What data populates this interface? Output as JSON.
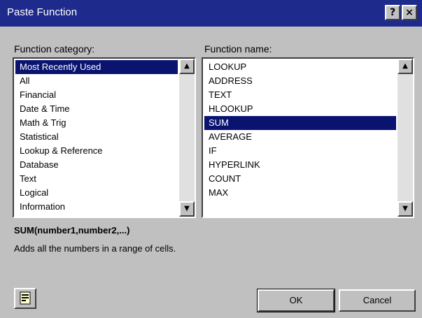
{
  "window": {
    "title": "Paste Function"
  },
  "title_buttons": {
    "help": "?",
    "close": "×"
  },
  "category": {
    "label": "Function category:",
    "items": [
      "Most Recently Used",
      "All",
      "Financial",
      "Date & Time",
      "Math & Trig",
      "Statistical",
      "Lookup & Reference",
      "Database",
      "Text",
      "Logical",
      "Information"
    ],
    "selected_index": 0
  },
  "function": {
    "label": "Function name:",
    "items": [
      "LOOKUP",
      "ADDRESS",
      "TEXT",
      "HLOOKUP",
      "SUM",
      "AVERAGE",
      "IF",
      "HYPERLINK",
      "COUNT",
      "MAX"
    ],
    "selected_index": 4
  },
  "scroll": {
    "up": "▲",
    "down": "▼"
  },
  "syntax": "SUM(number1,number2,...)",
  "description": "Adds all the numbers in a range of cells.",
  "buttons": {
    "ok": "OK",
    "cancel": "Cancel"
  },
  "colors": {
    "titlebar": "#1e2a8c",
    "selection": "#0a1470",
    "face": "#c0c0c0"
  }
}
